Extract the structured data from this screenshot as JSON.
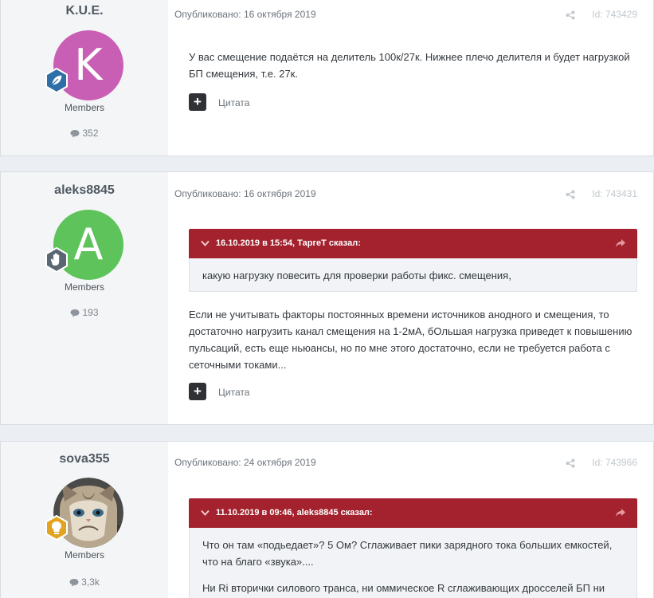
{
  "posts": [
    {
      "author": "K.U.E.",
      "avatar_letter": "K",
      "avatar_color": "#c95fb5",
      "badge_icon": "leaf-icon",
      "group": "Members",
      "post_count": "352",
      "published": "Опубликовано: 16 октября 2019",
      "post_id": "Id: 743429",
      "body": [
        "У вас смещение подаётся на делитель 100к/27к. Нижнее плечо делителя и будет нагрузкой",
        "БП смещения, т.е. 27к."
      ],
      "quote_label": "Цитата"
    },
    {
      "author": "aleks8845",
      "avatar_letter": "A",
      "avatar_color": "#5dc35a",
      "badge_icon": "hand-icon",
      "group": "Members",
      "post_count": "193",
      "published": "Опубликовано: 16 октября 2019",
      "post_id": "Id: 743431",
      "quote_header": "16.10.2019 в 15:54, ТаргеТ сказал:",
      "quote_text": [
        "какую нагрузку  повесить для проверки работы фикс. смещения,"
      ],
      "body": [
        "Если не учитывать факторы постоянных времени источников анодного и смещения, то",
        "достаточно нагрузить канал смещения на 1-2мА, бОльшая нагрузка приведет к повышению",
        "пульсаций, есть еще ньюансы, но по мне этого достаточно, если не требуется работа с",
        "сеточными токами..."
      ],
      "quote_label": "Цитата"
    },
    {
      "author": "sova355",
      "avatar_image": "grumpy-cat-photo",
      "badge_icon": "lightbulb-icon",
      "group": "Members",
      "post_count": "3,3k",
      "published": "Опубликовано: 24 октября 2019",
      "post_id": "Id: 743966",
      "quote_header": "11.10.2019 в 09:46, aleks8845 сказал:",
      "quote_text": [
        "Что он там «подьедает»? 5 Ом? Сглаживает пики зарядного тока больших емкостей,",
        "что на благо «звука»...."
      ],
      "quote_text_partial": "Ни Ri вторички силового транса, ни оммическое R сглаживающих дросселей БП ни"
    }
  ],
  "colors": {
    "quote_header_bg": "#a3222e",
    "author_panel_bg": "#f4f5f7",
    "page_bg": "#ebeef2"
  }
}
